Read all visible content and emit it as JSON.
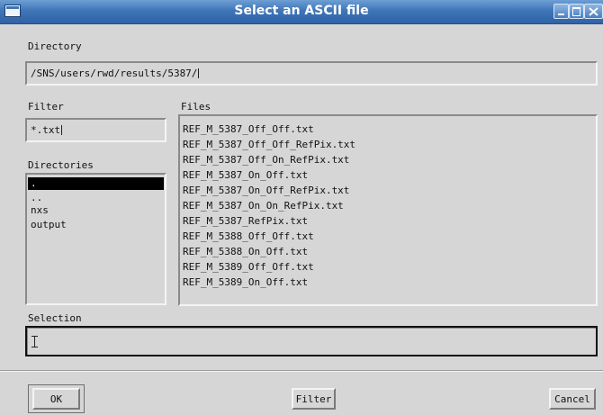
{
  "window": {
    "title": "Select an ASCII file"
  },
  "icons": {
    "window_icon": "window-icon",
    "minimize": "minimize-icon",
    "maximize": "maximize-icon",
    "close": "close-icon"
  },
  "directory": {
    "label": "Directory",
    "value": "/SNS/users/rwd/results/5387/"
  },
  "filter": {
    "label": "Filter",
    "value": "*.txt"
  },
  "directories": {
    "label": "Directories",
    "items": [
      ".",
      "..",
      "nxs",
      "output"
    ],
    "selected_index": 0
  },
  "files": {
    "label": "Files",
    "items": [
      "REF_M_5387_Off_Off.txt",
      "REF_M_5387_Off_Off_RefPix.txt",
      "REF_M_5387_Off_On_RefPix.txt",
      "REF_M_5387_On_Off.txt",
      "REF_M_5387_On_Off_RefPix.txt",
      "REF_M_5387_On_On_RefPix.txt",
      "REF_M_5387_RefPix.txt",
      "REF_M_5388_Off_Off.txt",
      "REF_M_5388_On_Off.txt",
      "REF_M_5389_Off_Off.txt",
      "REF_M_5389_On_Off.txt"
    ]
  },
  "selection": {
    "label": "Selection",
    "value": ""
  },
  "buttons": {
    "ok": "OK",
    "filter": "Filter",
    "cancel": "Cancel"
  },
  "colors": {
    "titlebar": "#3f75b8",
    "background": "#d6d6d6",
    "selected_item": "#000000"
  }
}
